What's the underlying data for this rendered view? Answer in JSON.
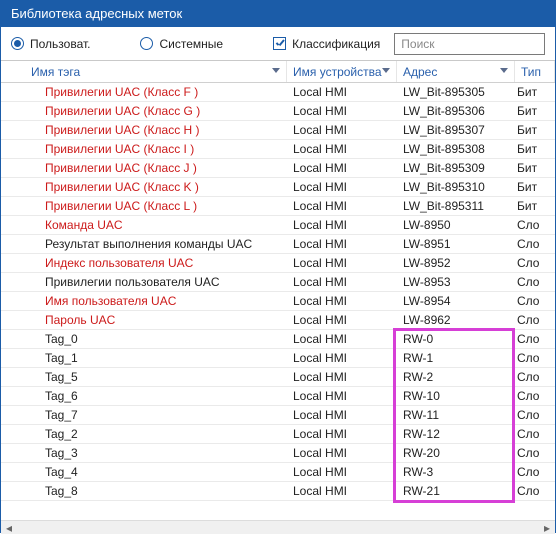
{
  "window": {
    "title": "Библиотека адресных меток"
  },
  "toolbar": {
    "radio_user": "Пользоват.",
    "radio_system": "Системные",
    "chk_class": "Классификация",
    "search_placeholder": "Поиск",
    "radio_user_on": true,
    "radio_system_on": false,
    "chk_class_on": true
  },
  "columns": {
    "name": "Имя тэга",
    "device": "Имя устройства",
    "address": "Адрес",
    "type": "Тип"
  },
  "rows": [
    {
      "name": "Привилегии UAC (Класс F )",
      "device": "Local HMI",
      "address": "LW_Bit-895305",
      "type": "Бит",
      "red": true
    },
    {
      "name": "Привилегии UAC (Класс G )",
      "device": "Local HMI",
      "address": "LW_Bit-895306",
      "type": "Бит",
      "red": true
    },
    {
      "name": "Привилегии UAC (Класс H )",
      "device": "Local HMI",
      "address": "LW_Bit-895307",
      "type": "Бит",
      "red": true
    },
    {
      "name": "Привилегии UAC (Класс I )",
      "device": "Local HMI",
      "address": "LW_Bit-895308",
      "type": "Бит",
      "red": true
    },
    {
      "name": "Привилегии UAC (Класс J )",
      "device": "Local HMI",
      "address": "LW_Bit-895309",
      "type": "Бит",
      "red": true
    },
    {
      "name": "Привилегии UAC (Класс K )",
      "device": "Local HMI",
      "address": "LW_Bit-895310",
      "type": "Бит",
      "red": true
    },
    {
      "name": "Привилегии UAC (Класс L )",
      "device": "Local HMI",
      "address": "LW_Bit-895311",
      "type": "Бит",
      "red": true
    },
    {
      "name": "Команда UAC",
      "device": "Local HMI",
      "address": "LW-8950",
      "type": "Сло",
      "red": true
    },
    {
      "name": "Результат выполнения команды UAC",
      "device": "Local HMI",
      "address": "LW-8951",
      "type": "Сло",
      "red": false
    },
    {
      "name": "Индекс пользователя UAC",
      "device": "Local HMI",
      "address": "LW-8952",
      "type": "Сло",
      "red": true
    },
    {
      "name": "Привилегии пользователя UAC",
      "device": "Local HMI",
      "address": "LW-8953",
      "type": "Сло",
      "red": false
    },
    {
      "name": "Имя пользователя UAC",
      "device": "Local HMI",
      "address": "LW-8954",
      "type": "Сло",
      "red": true
    },
    {
      "name": "Пароль UAC",
      "device": "Local HMI",
      "address": "LW-8962",
      "type": "Сло",
      "red": true
    },
    {
      "name": "Tag_0",
      "device": "Local HMI",
      "address": "RW-0",
      "type": "Сло",
      "red": false
    },
    {
      "name": "Tag_1",
      "device": "Local HMI",
      "address": "RW-1",
      "type": "Сло",
      "red": false
    },
    {
      "name": "Tag_5",
      "device": "Local HMI",
      "address": "RW-2",
      "type": "Сло",
      "red": false
    },
    {
      "name": "Tag_6",
      "device": "Local HMI",
      "address": "RW-10",
      "type": "Сло",
      "red": false
    },
    {
      "name": "Tag_7",
      "device": "Local HMI",
      "address": "RW-11",
      "type": "Сло",
      "red": false
    },
    {
      "name": "Tag_2",
      "device": "Local HMI",
      "address": "RW-12",
      "type": "Сло",
      "red": false
    },
    {
      "name": "Tag_3",
      "device": "Local HMI",
      "address": "RW-20",
      "type": "Сло",
      "red": false
    },
    {
      "name": "Tag_4",
      "device": "Local HMI",
      "address": "RW-3",
      "type": "Сло",
      "red": false
    },
    {
      "name": "Tag_8",
      "device": "Local HMI",
      "address": "RW-21",
      "type": "Сло",
      "red": false
    }
  ],
  "highlight": {
    "from_row": 13,
    "rows": 9
  }
}
